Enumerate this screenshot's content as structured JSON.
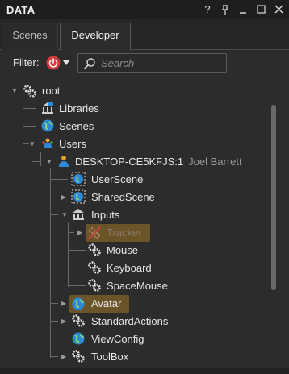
{
  "window": {
    "title": "DATA",
    "help_label": "?"
  },
  "tabs": [
    {
      "label": "Scenes"
    },
    {
      "label": "Developer"
    }
  ],
  "filter": {
    "label": "Filter:",
    "search_placeholder": "Search",
    "power_color": "#d23a3a"
  },
  "tree": {
    "root": "root",
    "libraries": "Libraries",
    "scenes": "Scenes",
    "users": "Users",
    "desktop": "DESKTOP-CE5KFJS:1",
    "desktop_user": "Joel Barrett",
    "user_scene": "UserScene",
    "shared_scene": "SharedScene",
    "inputs": "Inputs",
    "tracker": "Tracker",
    "mouse": "Mouse",
    "keyboard": "Keyboard",
    "spacemouse": "SpaceMouse",
    "avatar": "Avatar",
    "standard_actions": "StandardActions",
    "view_config": "ViewConfig",
    "toolbox": "ToolBox"
  },
  "colors": {
    "highlight": "#6b5428",
    "accent_blue": "#2a8ad8"
  }
}
